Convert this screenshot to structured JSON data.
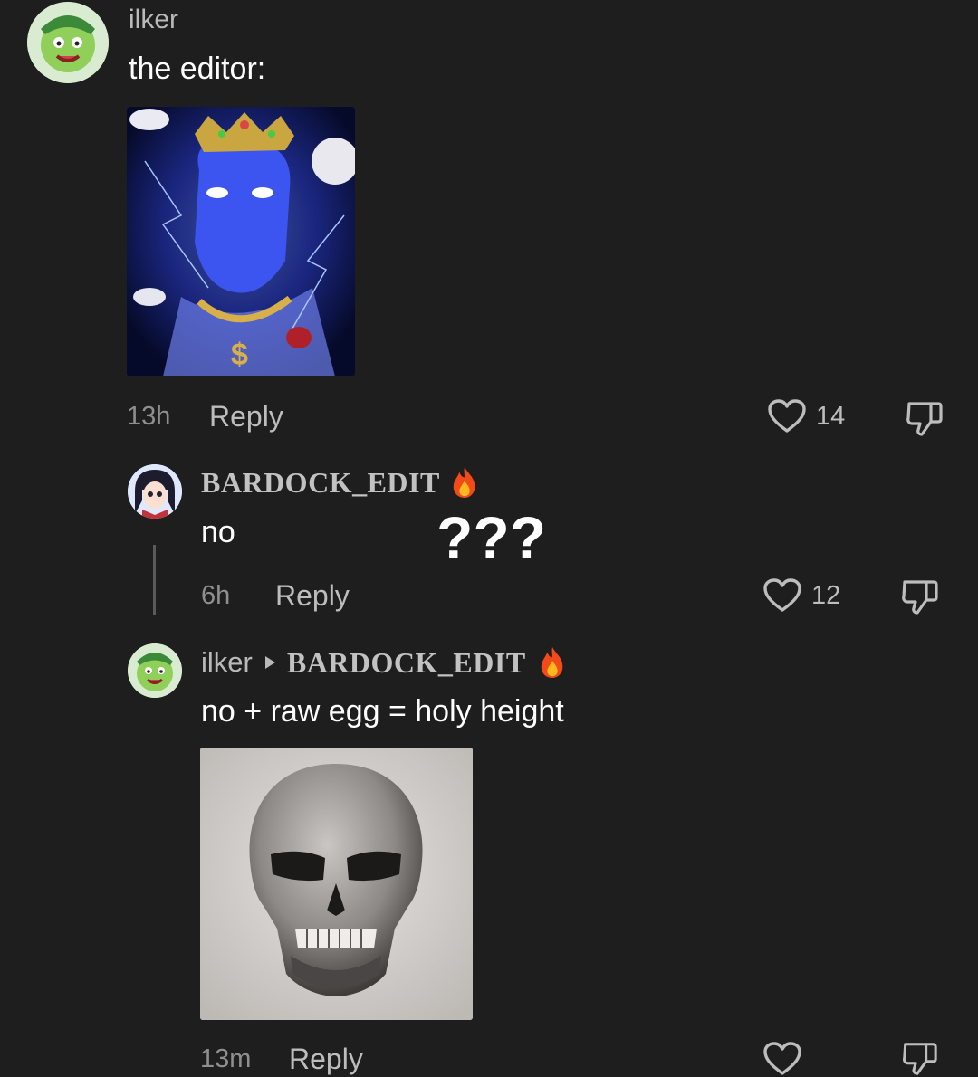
{
  "comments": [
    {
      "username": "ilker",
      "text": "the editor:",
      "time": "13h",
      "reply_label": "Reply",
      "likes": "14"
    },
    {
      "username": "BARDOCK_EDIT",
      "text": "no",
      "time": "6h",
      "reply_label": "Reply",
      "likes": "12"
    },
    {
      "username": "ilker",
      "reply_to": "BARDOCK_EDIT",
      "text": "no + raw egg = holy height",
      "time": "13m",
      "reply_label": "Reply",
      "likes": ""
    }
  ],
  "overlay_text": "???",
  "icons": {
    "like": "heart-outline-icon",
    "dislike": "thumbs-down-outline-icon",
    "verified_emoji": "fire-emoji",
    "reply_arrow": "caret-right-icon"
  },
  "colors": {
    "background": "#1e1e1e",
    "meta_gray": "#8f8f8f",
    "text_white": "#ffffff"
  }
}
